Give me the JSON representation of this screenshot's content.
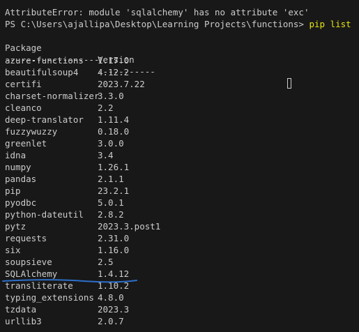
{
  "terminal": {
    "partial_top_line": "^^^^^^^^^^^^^",
    "error_line": "AttributeError: module 'sqlalchemy' has no attribute 'exc'",
    "prompt": {
      "path": "PS C:\\Users\\ajallipa\\Desktop\\Learning Projects\\functions>",
      "command": "pip list"
    },
    "table": {
      "header": {
        "name": "Package",
        "version": "Version"
      },
      "separator": {
        "name": "------------------",
        "version": "-----------"
      },
      "rows": [
        {
          "name": "azure-functions",
          "version": "1.17.0"
        },
        {
          "name": "beautifulsoup4",
          "version": "4.12.2"
        },
        {
          "name": "certifi",
          "version": "2023.7.22"
        },
        {
          "name": "charset-normalizer",
          "version": "3.3.0"
        },
        {
          "name": "cleanco",
          "version": "2.2"
        },
        {
          "name": "deep-translator",
          "version": "1.11.4"
        },
        {
          "name": "fuzzywuzzy",
          "version": "0.18.0"
        },
        {
          "name": "greenlet",
          "version": "3.0.0"
        },
        {
          "name": "idna",
          "version": "3.4"
        },
        {
          "name": "numpy",
          "version": "1.26.1"
        },
        {
          "name": "pandas",
          "version": "2.1.1"
        },
        {
          "name": "pip",
          "version": "23.2.1"
        },
        {
          "name": "pyodbc",
          "version": "5.0.1"
        },
        {
          "name": "python-dateutil",
          "version": "2.8.2"
        },
        {
          "name": "pytz",
          "version": "2023.3.post1"
        },
        {
          "name": "requests",
          "version": "2.31.0"
        },
        {
          "name": "six",
          "version": "1.16.0"
        },
        {
          "name": "soupsieve",
          "version": "2.5"
        },
        {
          "name": "SQLAlchemy",
          "version": "1.4.12"
        },
        {
          "name": "transliterate",
          "version": "1.10.2"
        },
        {
          "name": "typing_extensions",
          "version": "4.8.0"
        },
        {
          "name": "tzdata",
          "version": "2023.3"
        },
        {
          "name": "urllib3",
          "version": "2.0.7"
        }
      ]
    }
  },
  "colors": {
    "background": "#181818",
    "text": "#cccccc",
    "command": "#e5e510",
    "annotation": "#2d6fc9"
  }
}
